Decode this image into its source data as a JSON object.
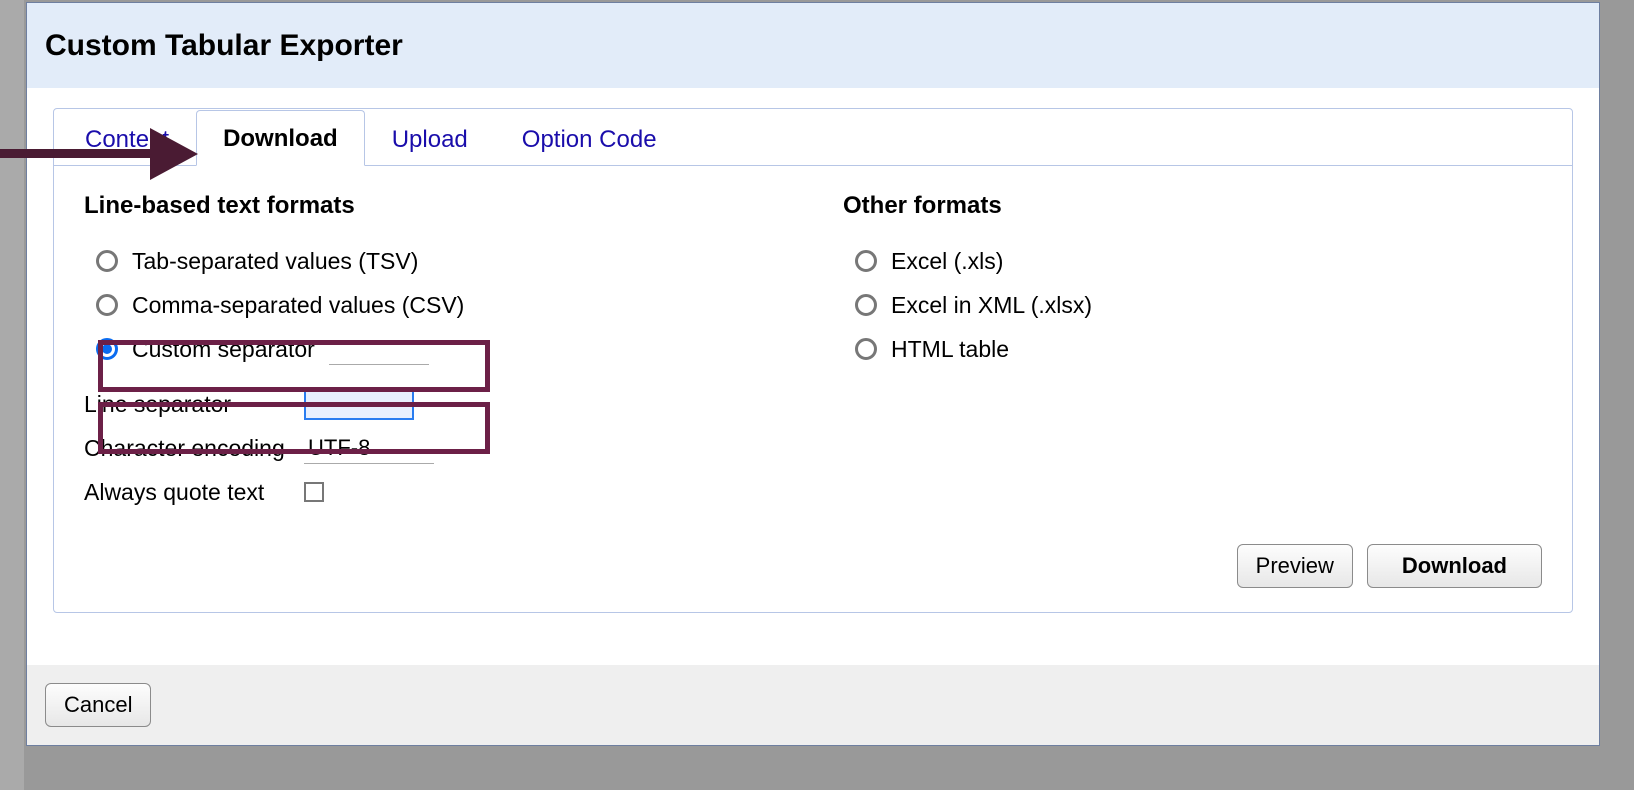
{
  "dialog": {
    "title": "Custom Tabular Exporter"
  },
  "tabs": {
    "content": "Content",
    "download": "Download",
    "upload": "Upload",
    "option_code": "Option Code"
  },
  "download_panel": {
    "line_formats_heading": "Line-based text formats",
    "other_formats_heading": "Other formats",
    "radios": {
      "tsv": "Tab-separated values (TSV)",
      "csv": "Comma-separated values (CSV)",
      "custom": "Custom separator",
      "xls": "Excel (.xls)",
      "xlsx": "Excel in XML (.xlsx)",
      "html": "HTML table"
    },
    "settings": {
      "line_separator_label": "Line separator",
      "line_separator_value": "",
      "encoding_label": "Character encoding",
      "encoding_value": "UTF-8",
      "always_quote_label": "Always quote text"
    },
    "buttons": {
      "preview": "Preview",
      "download": "Download"
    }
  },
  "footer": {
    "cancel": "Cancel"
  },
  "annotations": {
    "arrow_target": "download-tab",
    "highlight_boxes": [
      "custom-separator-row",
      "line-separator-row"
    ]
  }
}
